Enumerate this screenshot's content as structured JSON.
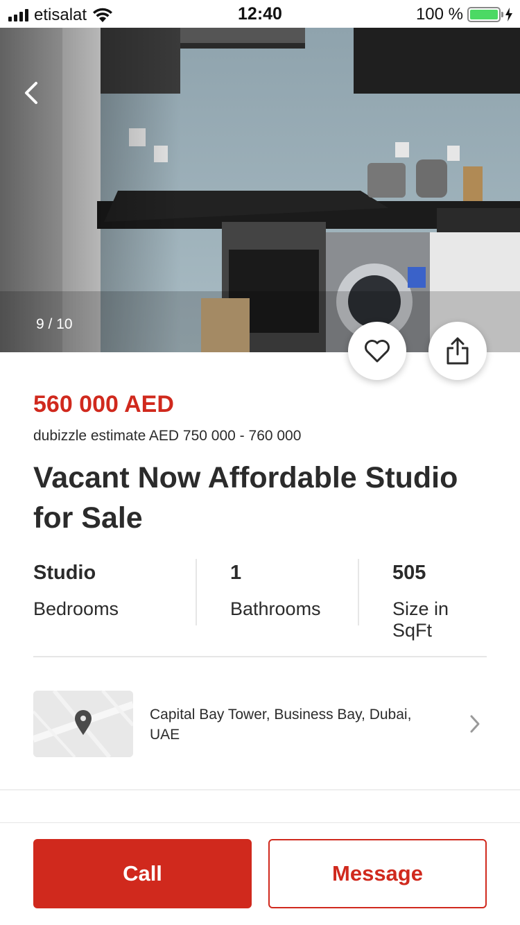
{
  "status_bar": {
    "carrier": "etisalat",
    "time": "12:40",
    "battery": "100 %",
    "battery_color": "#4cd964"
  },
  "gallery": {
    "counter": "9 / 10",
    "back_icon": "chevron-left-icon",
    "favorite_icon": "heart-icon",
    "share_icon": "share-icon"
  },
  "listing": {
    "price": "560 000 AED",
    "estimate": "dubizzle estimate AED 750 000 - 760 000",
    "title": "Vacant Now Affordable Studio for Sale"
  },
  "specs": [
    {
      "value": "Studio",
      "label": "Bedrooms"
    },
    {
      "value": "1",
      "label": "Bathrooms"
    },
    {
      "value": "505",
      "label": "Size in SqFt"
    }
  ],
  "location": {
    "address": "Capital Bay Tower, Business Bay, Dubai, UAE",
    "map_icon": "map-pin-icon"
  },
  "actions": {
    "call": "Call",
    "message": "Message"
  },
  "colors": {
    "accent": "#d0291d",
    "text": "#2b2b2b"
  }
}
